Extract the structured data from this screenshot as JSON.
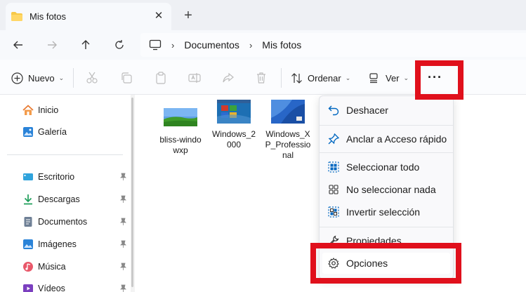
{
  "tab": {
    "title": "Mis fotos",
    "close_glyph": "✕",
    "new_tab_glyph": "+"
  },
  "breadcrumb": {
    "items": [
      "Documentos",
      "Mis fotos"
    ],
    "separator": "›"
  },
  "toolbar": {
    "new_label": "Nuevo",
    "sort_label": "Ordenar",
    "view_label": "Ver",
    "more_label": "···",
    "chevron": "⌄"
  },
  "sidebar": {
    "top_items": [
      {
        "label": "Inicio",
        "icon": "home-icon"
      },
      {
        "label": "Galería",
        "icon": "gallery-icon"
      }
    ],
    "pinned_items": [
      {
        "label": "Escritorio",
        "icon": "desktop-folder-icon"
      },
      {
        "label": "Descargas",
        "icon": "downloads-folder-icon"
      },
      {
        "label": "Documentos",
        "icon": "documents-folder-icon"
      },
      {
        "label": "Imágenes",
        "icon": "pictures-folder-icon"
      },
      {
        "label": "Música",
        "icon": "music-folder-icon"
      },
      {
        "label": "Vídeos",
        "icon": "videos-folder-icon"
      }
    ],
    "pin_glyph": "📌"
  },
  "files": [
    {
      "name_line1": "bliss-windo",
      "name_line2": "wxp",
      "name_line3": ""
    },
    {
      "name_line1": "Windows_2",
      "name_line2": "000",
      "name_line3": ""
    },
    {
      "name_line1": "Windows_X",
      "name_line2": "P_Professio",
      "name_line3": "nal"
    }
  ],
  "menu": {
    "items": [
      {
        "label": "Deshacer",
        "icon": "undo-icon"
      },
      {
        "label": "Anclar a Acceso rápido",
        "icon": "pin-icon"
      },
      {
        "label": "Seleccionar todo",
        "icon": "select-all-icon"
      },
      {
        "label": "No seleccionar nada",
        "icon": "select-none-icon"
      },
      {
        "label": "Invertir selección",
        "icon": "invert-selection-icon"
      },
      {
        "label": "Propiedades",
        "icon": "properties-icon"
      },
      {
        "label": "Opciones",
        "icon": "gear-icon"
      }
    ]
  },
  "colors": {
    "highlight_red": "#e0101c",
    "accent_blue": "#0067c0",
    "folder_yellow": "#f7c948"
  }
}
